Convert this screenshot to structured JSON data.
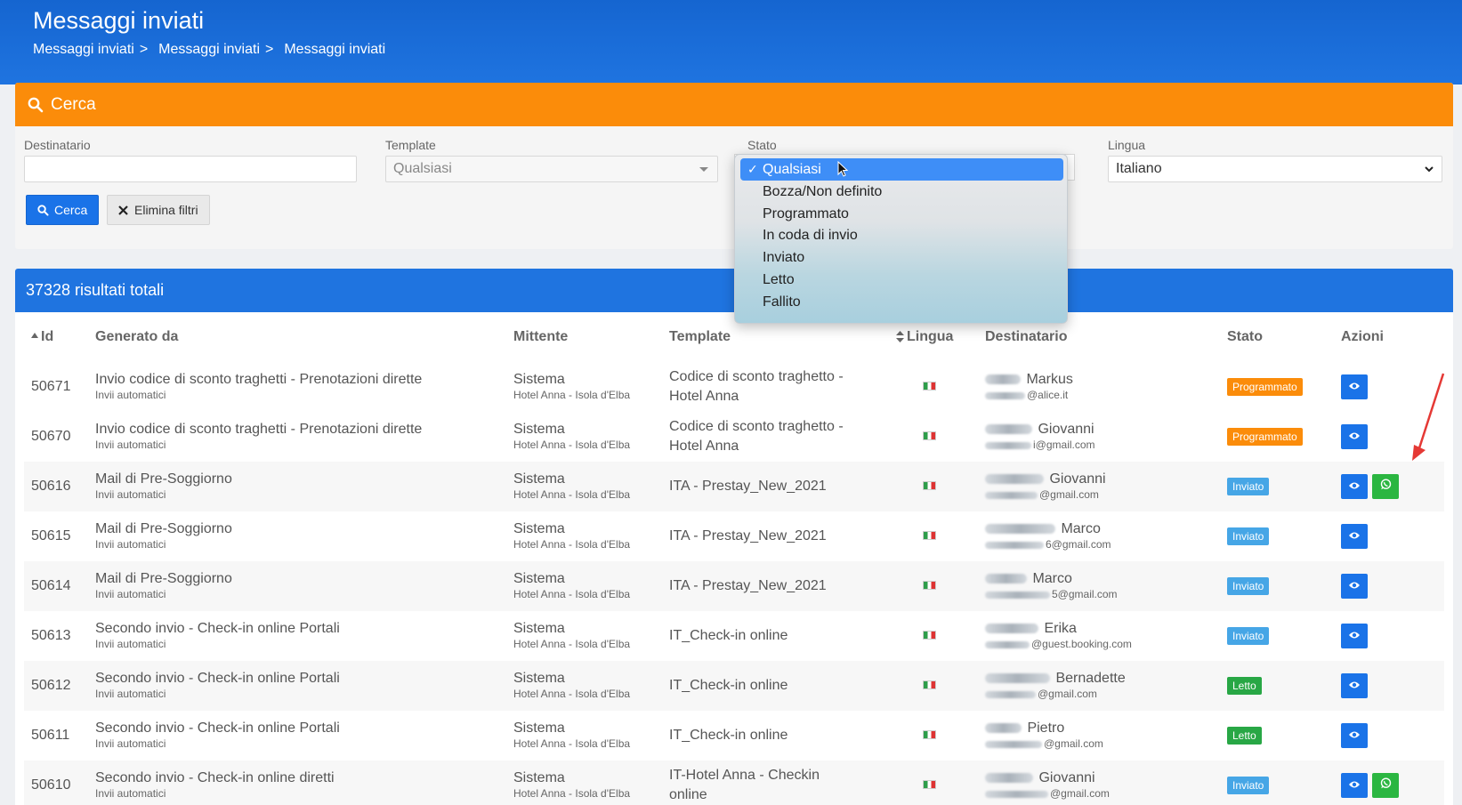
{
  "header": {
    "title": "Messaggi inviati",
    "breadcrumb": [
      "Messaggi inviati",
      "Messaggi inviati",
      "Messaggi inviati"
    ],
    "breadcrumb_sep": ">"
  },
  "search": {
    "title": "Cerca",
    "filters": {
      "destinatario_label": "Destinatario",
      "destinatario_value": "",
      "template_label": "Template",
      "template_value": "Qualsiasi",
      "stato_label": "Stato",
      "lingua_label": "Lingua",
      "lingua_value": "Italiano"
    },
    "search_button": "Cerca",
    "clear_button": "Elimina filtri"
  },
  "stato_dropdown": {
    "selected": "Qualsiasi",
    "options": [
      "Qualsiasi",
      "Bozza/Non definito",
      "Programmato",
      "In coda di invio",
      "Inviato",
      "Letto",
      "Fallito"
    ],
    "check": "✓"
  },
  "results": {
    "total_label": "37328 risultati totali",
    "columns": [
      "Id",
      "Generato da",
      "Mittente",
      "Template",
      "Lingua",
      "Destinatario",
      "Stato",
      "Azioni"
    ],
    "rows": [
      {
        "id": "50671",
        "gen": "Invio codice di sconto traghetti - Prenotazioni dirette",
        "gen_sub": "Invii automatici",
        "sender": "Sistema",
        "sender_sub": "Hotel Anna - Isola d'Elba",
        "template": "Codice di sconto traghetto - Hotel Anna",
        "dest_name": "Markus",
        "dest_email": "@alice.it",
        "stato": "Programmato",
        "wa": false
      },
      {
        "id": "50670",
        "gen": "Invio codice di sconto traghetti - Prenotazioni dirette",
        "gen_sub": "Invii automatici",
        "sender": "Sistema",
        "sender_sub": "Hotel Anna - Isola d'Elba",
        "template": "Codice di sconto traghetto - Hotel Anna",
        "dest_name": "Giovanni",
        "dest_email": "i@gmail.com",
        "stato": "Programmato",
        "wa": false
      },
      {
        "id": "50616",
        "gen": "Mail di Pre-Soggiorno",
        "gen_sub": "Invii automatici",
        "sender": "Sistema",
        "sender_sub": "Hotel Anna - Isola d'Elba",
        "template": "ITA - Prestay_New_2021",
        "dest_name": "Giovanni",
        "dest_email": "@gmail.com",
        "stato": "Inviato",
        "wa": true
      },
      {
        "id": "50615",
        "gen": "Mail di Pre-Soggiorno",
        "gen_sub": "Invii automatici",
        "sender": "Sistema",
        "sender_sub": "Hotel Anna - Isola d'Elba",
        "template": "ITA - Prestay_New_2021",
        "dest_name": "Marco",
        "dest_email": "6@gmail.com",
        "stato": "Inviato",
        "wa": false
      },
      {
        "id": "50614",
        "gen": "Mail di Pre-Soggiorno",
        "gen_sub": "Invii automatici",
        "sender": "Sistema",
        "sender_sub": "Hotel Anna - Isola d'Elba",
        "template": "ITA - Prestay_New_2021",
        "dest_name": "Marco",
        "dest_email": "5@gmail.com",
        "stato": "Inviato",
        "wa": false
      },
      {
        "id": "50613",
        "gen": "Secondo invio - Check-in online Portali",
        "gen_sub": "Invii automatici",
        "sender": "Sistema",
        "sender_sub": "Hotel Anna - Isola d'Elba",
        "template": "IT_Check-in online",
        "dest_name": "Erika",
        "dest_email": "@guest.booking.com",
        "stato": "Inviato",
        "wa": false
      },
      {
        "id": "50612",
        "gen": "Secondo invio - Check-in online Portali",
        "gen_sub": "Invii automatici",
        "sender": "Sistema",
        "sender_sub": "Hotel Anna - Isola d'Elba",
        "template": "IT_Check-in online",
        "dest_name": "Bernadette",
        "dest_email": "@gmail.com",
        "stato": "Letto",
        "wa": false
      },
      {
        "id": "50611",
        "gen": "Secondo invio - Check-in online Portali",
        "gen_sub": "Invii automatici",
        "sender": "Sistema",
        "sender_sub": "Hotel Anna - Isola d'Elba",
        "template": "IT_Check-in online",
        "dest_name": "Pietro",
        "dest_email": "@gmail.com",
        "stato": "Letto",
        "wa": false
      },
      {
        "id": "50610",
        "gen": "Secondo invio - Check-in online diretti",
        "gen_sub": "Invii automatici",
        "sender": "Sistema",
        "sender_sub": "Hotel Anna - Isola d'Elba",
        "template": "IT-Hotel Anna - Checkin online",
        "dest_name": "Giovanni",
        "dest_email": "@gmail.com",
        "stato": "Inviato",
        "wa": true
      }
    ]
  },
  "icons": {
    "search": "search-icon",
    "clear": "x-icon",
    "view": "eye-icon",
    "whatsapp": "whatsapp-icon",
    "sort": "sort-icon"
  },
  "colors": {
    "header": "#1f74e0",
    "search_bar": "#fb8c0a",
    "primary": "#1a73e8",
    "programmato": "#fb8c0a",
    "inviato": "#46a6e6",
    "letto": "#28a745",
    "whatsapp": "#2bb641",
    "annotation_arrow": "#e53935"
  }
}
